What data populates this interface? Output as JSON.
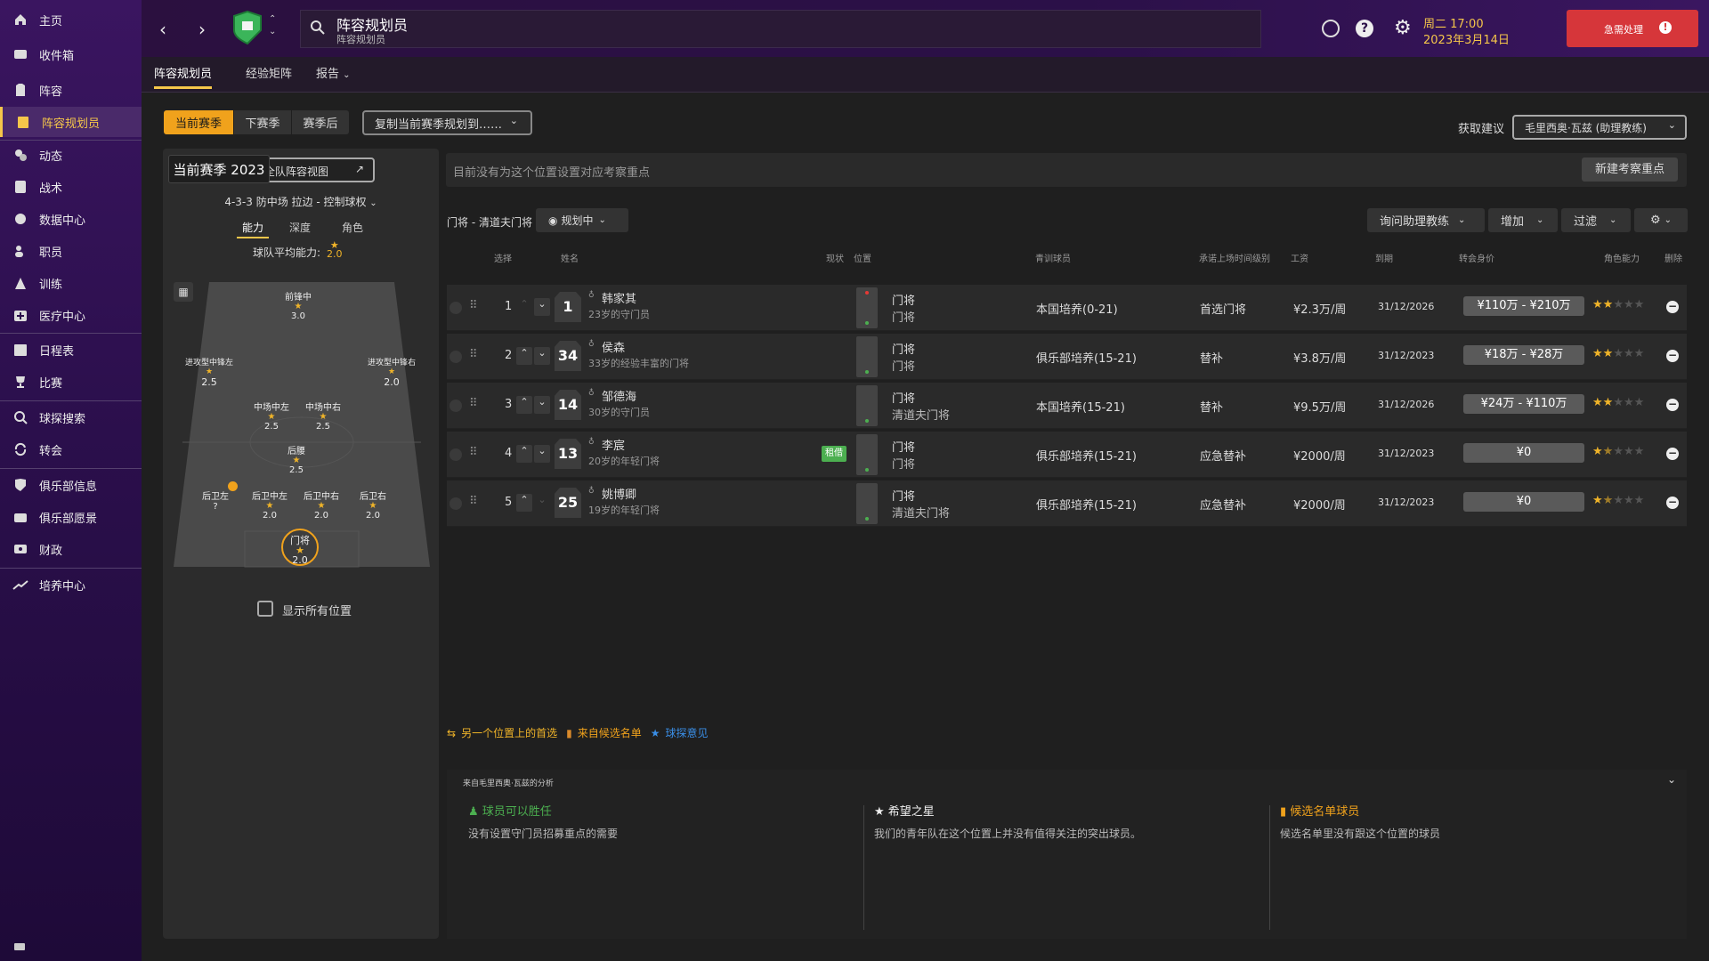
{
  "sidebar": {
    "items": [
      {
        "label": "主页",
        "icon": "home-icon"
      },
      {
        "label": "收件箱",
        "icon": "inbox-icon"
      },
      {
        "label": "阵容",
        "icon": "squad-icon"
      },
      {
        "label": "阵容规划员",
        "icon": "clipboard-icon"
      },
      {
        "label": "动态",
        "icon": "dynamics-icon"
      },
      {
        "label": "战术",
        "icon": "tactics-icon"
      },
      {
        "label": "数据中心",
        "icon": "data-hub-icon"
      },
      {
        "label": "职员",
        "icon": "staff-icon"
      },
      {
        "label": "训练",
        "icon": "training-icon"
      },
      {
        "label": "医疗中心",
        "icon": "medical-icon"
      },
      {
        "label": "日程表",
        "icon": "calendar-icon"
      },
      {
        "label": "比赛",
        "icon": "trophy-icon"
      },
      {
        "label": "球探搜索",
        "icon": "search-icon"
      },
      {
        "label": "转会",
        "icon": "transfer-icon"
      },
      {
        "label": "俱乐部信息",
        "icon": "shield-icon"
      },
      {
        "label": "俱乐部愿景",
        "icon": "vision-icon"
      },
      {
        "label": "财政",
        "icon": "finance-icon"
      },
      {
        "label": "培养中心",
        "icon": "development-icon"
      }
    ]
  },
  "topbar": {
    "title": "阵容规划员",
    "subtitle": "阵容规划员",
    "day_time": "周二 17:00",
    "date": "2023年3月14日",
    "urgent_label": "急需处理"
  },
  "subnav": {
    "tabs": [
      "阵容规划员",
      "经验矩阵",
      "报告"
    ]
  },
  "toolbar": {
    "season_tabs": [
      "当前赛季",
      "下赛季",
      "赛季后"
    ],
    "copy_label": "复制当前赛季规划到……",
    "advice_label": "获取建议",
    "advisor": "毛里西奥·瓦兹 (助理教练)"
  },
  "pitch": {
    "season_title": "当前赛季 2023",
    "team_view_label": "全队阵容视图",
    "formation": "4-3-3 防中场 拉边 - 控制球权",
    "view_tabs": [
      "能力",
      "深度",
      "角色"
    ],
    "avg_label": "球队平均能力:",
    "avg_value": "2.0",
    "positions": [
      {
        "name": "前锋中",
        "rating": "3.0"
      },
      {
        "name": "进攻型中锋左",
        "rating": "2.5"
      },
      {
        "name": "进攻型中锋右",
        "rating": "2.0"
      },
      {
        "name": "中场中左",
        "rating": "2.5"
      },
      {
        "name": "中场中右",
        "rating": "2.5"
      },
      {
        "name": "后腰",
        "rating": "2.5"
      },
      {
        "name": "后卫左",
        "rating": "?"
      },
      {
        "name": "后卫中左",
        "rating": "2.0"
      },
      {
        "name": "后卫中右",
        "rating": "2.0"
      },
      {
        "name": "后卫右",
        "rating": "2.0"
      },
      {
        "name": "门将",
        "rating": "2.0"
      }
    ],
    "show_all_label": "显示所有位置"
  },
  "focus_bar": {
    "text": "目前没有为这个位置设置对应考察重点",
    "new_button": "新建考察重点"
  },
  "filterbar": {
    "position_label": "门将 - 清道夫门将",
    "planning_label": "规划中",
    "ask_label": "询问助理教练",
    "add_label": "增加",
    "filter_label": "过滤"
  },
  "table": {
    "headers": [
      "选择",
      "姓名",
      "现状",
      "位置",
      "青训球员",
      "承诺上场时间级别",
      "工资",
      "到期",
      "转会身价",
      "角色能力",
      "删除"
    ],
    "rows": [
      {
        "idx": "1",
        "number": "1",
        "name": "韩家其",
        "desc": "23岁的守门员",
        "status": "",
        "pos1": "门将",
        "pos2": "门将",
        "youth": "本国培养(0-21)",
        "playing": "首选门将",
        "wage": "¥2.3万/周",
        "expiry": "31/12/2026",
        "value": "¥110万 - ¥210万",
        "stars": 2.0
      },
      {
        "idx": "2",
        "number": "34",
        "name": "侯森",
        "desc": "33岁的经验丰富的门将",
        "status": "",
        "pos1": "门将",
        "pos2": "门将",
        "youth": "俱乐部培养(15-21)",
        "playing": "替补",
        "wage": "¥3.8万/周",
        "expiry": "31/12/2023",
        "value": "¥18万 - ¥28万",
        "stars": 2.0
      },
      {
        "idx": "3",
        "number": "14",
        "name": "邹德海",
        "desc": "30岁的守门员",
        "status": "",
        "pos1": "门将",
        "pos2": "清道夫门将",
        "youth": "本国培养(15-21)",
        "playing": "替补",
        "wage": "¥9.5万/周",
        "expiry": "31/12/2026",
        "value": "¥24万 - ¥110万",
        "stars": 2.0
      },
      {
        "idx": "4",
        "number": "13",
        "name": "李宸",
        "desc": "20岁的年轻门将",
        "status": "租借",
        "pos1": "门将",
        "pos2": "门将",
        "youth": "俱乐部培养(15-21)",
        "playing": "应急替补",
        "wage": "¥2000/周",
        "expiry": "31/12/2023",
        "value": "¥0",
        "stars": 1.5
      },
      {
        "idx": "5",
        "number": "25",
        "name": "姚博卿",
        "desc": "19岁的年轻门将",
        "status": "",
        "pos1": "门将",
        "pos2": "清道夫门将",
        "youth": "俱乐部培养(15-21)",
        "playing": "应急替补",
        "wage": "¥2000/周",
        "expiry": "31/12/2023",
        "value": "¥0",
        "stars": 1.5
      }
    ]
  },
  "legend": {
    "first_choice": "另一个位置上的首选",
    "shortlist": "来自候选名单",
    "scout": "球探意见"
  },
  "analysis": {
    "header": "来自毛里西奥·瓦兹的分析",
    "cards": [
      {
        "title": "球员可以胜任",
        "text": "没有设置守门员招募重点的需要"
      },
      {
        "title": "希望之星",
        "text": "我们的青年队在这个位置上并没有值得关注的突出球员。"
      },
      {
        "title": "候选名单球员",
        "text": "候选名单里没有跟这个位置的球员"
      }
    ]
  }
}
